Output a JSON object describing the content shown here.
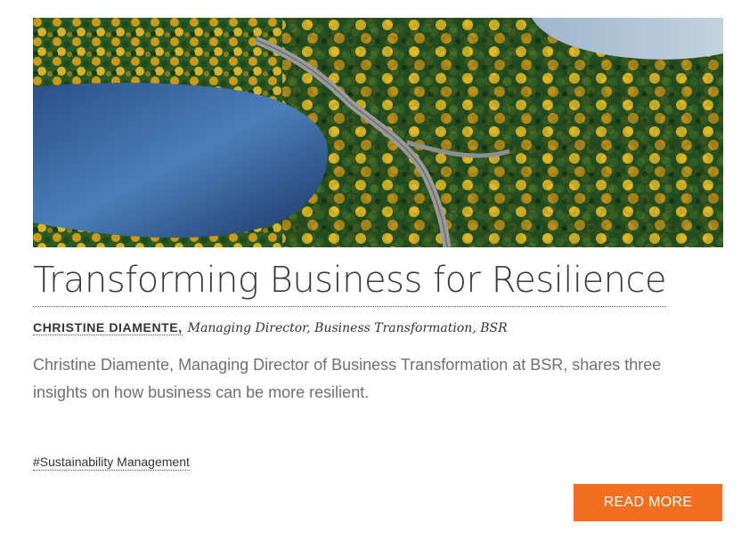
{
  "article": {
    "image_alt": "Aerial view of autumn forest with lakes and winding road",
    "title": "Transforming Business for Resilience",
    "author_name": "CHRISTINE DIAMENTE,",
    "author_role": "Managing Director, Business Transformation, BSR",
    "summary": "Christine Diamente, Managing Director of Business Transformation at BSR, shares three insights on how business can be more resilient.",
    "tag": "#Sustainability Management",
    "read_more_label": "READ MORE"
  },
  "colors": {
    "accent": "#f26f21",
    "title": "#3a3a3a",
    "summary": "#707070"
  }
}
